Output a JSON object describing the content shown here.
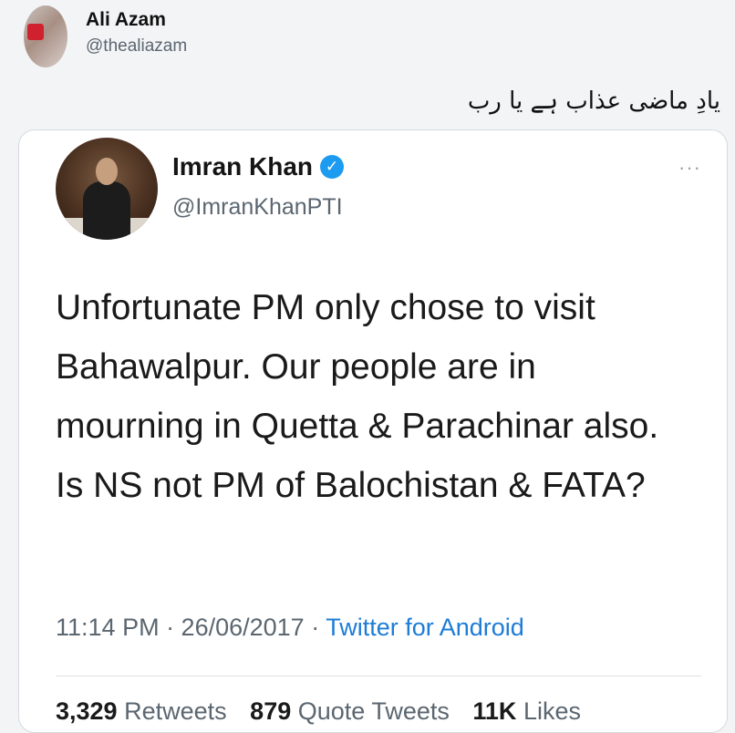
{
  "outer": {
    "name": "Ali Azam",
    "handle": "@thealiazam",
    "text": "یادِ ماضی عذاب ہے یا رب"
  },
  "inner": {
    "name": "Imran Khan",
    "handle": "@ImranKhanPTI",
    "verified_mark": "✓",
    "more": "···",
    "text": "Unfortunate PM only chose to visit Bahawalpur. Our people are in mourning in Quetta & Parachinar also. Is NS not PM of Balochistan & FATA?",
    "time": "11:14 PM · 26/06/2017 · ",
    "source": "Twitter for Android",
    "retweets_count": "3,329",
    "retweets_label": "Retweets",
    "quotes_count": "879",
    "quotes_label": "Quote Tweets",
    "likes_count": "11K",
    "likes_label": "Likes"
  },
  "colors": {
    "accent": "#1d9bf0",
    "link": "#1d7cd6"
  }
}
